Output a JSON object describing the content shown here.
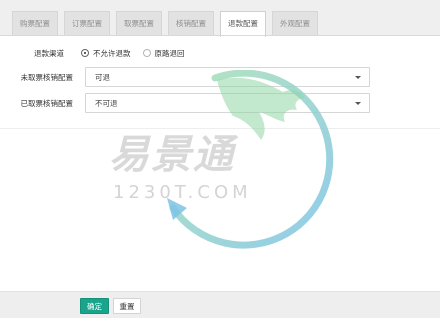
{
  "tabs": [
    {
      "label": "购票配置",
      "active": false
    },
    {
      "label": "订票配置",
      "active": false
    },
    {
      "label": "取票配置",
      "active": false
    },
    {
      "label": "核销配置",
      "active": false
    },
    {
      "label": "退款配置",
      "active": true
    },
    {
      "label": "外观配置",
      "active": false
    }
  ],
  "form": {
    "refund_channel": {
      "label": "退款渠道",
      "options": [
        {
          "label": "不允许退款",
          "checked": true
        },
        {
          "label": "原路退回",
          "checked": false
        }
      ]
    },
    "unticketed_verify": {
      "label": "未取票核销配置",
      "value": "可退"
    },
    "ticketed_verify": {
      "label": "已取票核销配置",
      "value": "不可退"
    }
  },
  "watermark": {
    "brand": "易景通",
    "domain": "1230T.COM"
  },
  "footer": {
    "confirm_label": "确定",
    "reset_label": "重置"
  },
  "colors": {
    "accent": "#1aa48c",
    "watermark_green": "#8fd6a6",
    "watermark_blue": "#6fb6de"
  }
}
